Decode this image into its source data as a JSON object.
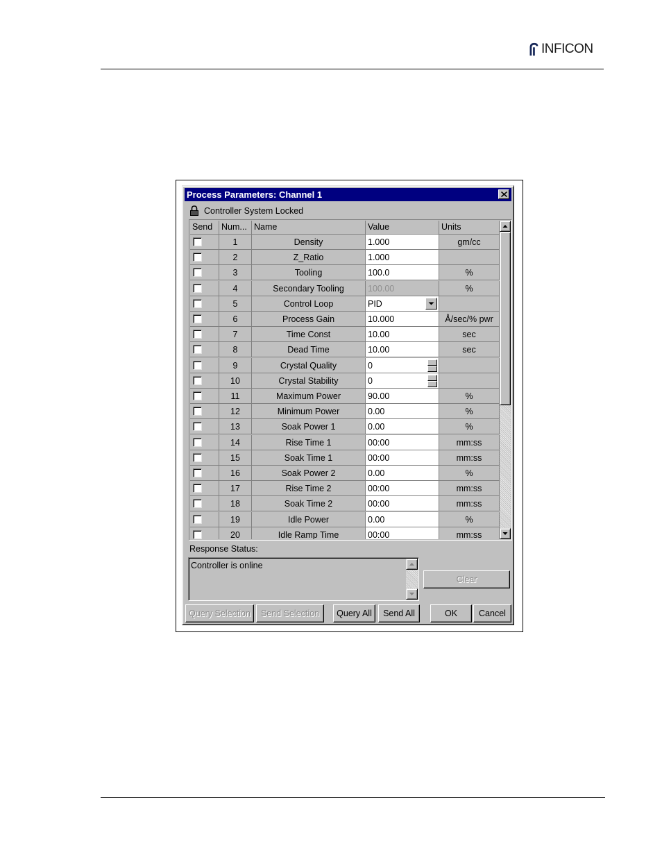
{
  "brand": {
    "logo_text": "INFICON"
  },
  "dialog": {
    "title": "Process Parameters: Channel 1",
    "lock_status": "Controller System Locked",
    "columns": [
      "Send",
      "Num...",
      "Name",
      "Value",
      "Units"
    ],
    "rows": [
      {
        "num": "1",
        "name": "Density",
        "value": "1.000",
        "units": "gm/cc",
        "control": "text"
      },
      {
        "num": "2",
        "name": "Z_Ratio",
        "value": "1.000",
        "units": "",
        "control": "text"
      },
      {
        "num": "3",
        "name": "Tooling",
        "value": "100.0",
        "units": "%",
        "control": "text"
      },
      {
        "num": "4",
        "name": "Secondary Tooling",
        "value": "100.00",
        "units": "%",
        "control": "disabled"
      },
      {
        "num": "5",
        "name": "Control Loop",
        "value": "PID",
        "units": "",
        "control": "dropdown"
      },
      {
        "num": "6",
        "name": "Process Gain",
        "value": "10.000",
        "units": "Å/sec/% pwr",
        "control": "text"
      },
      {
        "num": "7",
        "name": "Time Const",
        "value": "10.00",
        "units": "sec",
        "control": "text"
      },
      {
        "num": "8",
        "name": "Dead Time",
        "value": "10.00",
        "units": "sec",
        "control": "text"
      },
      {
        "num": "9",
        "name": "Crystal Quality",
        "value": "0",
        "units": "",
        "control": "spin"
      },
      {
        "num": "10",
        "name": "Crystal Stability",
        "value": "0",
        "units": "",
        "control": "spin"
      },
      {
        "num": "11",
        "name": "Maximum Power",
        "value": "90.00",
        "units": "%",
        "control": "text"
      },
      {
        "num": "12",
        "name": "Minimum Power",
        "value": "0.00",
        "units": "%",
        "control": "text"
      },
      {
        "num": "13",
        "name": "Soak Power 1",
        "value": "0.00",
        "units": "%",
        "control": "text"
      },
      {
        "num": "14",
        "name": "Rise Time 1",
        "value": "00:00",
        "units": "mm:ss",
        "control": "text"
      },
      {
        "num": "15",
        "name": "Soak Time 1",
        "value": "00:00",
        "units": "mm:ss",
        "control": "text"
      },
      {
        "num": "16",
        "name": "Soak Power 2",
        "value": "0.00",
        "units": "%",
        "control": "text"
      },
      {
        "num": "17",
        "name": "Rise Time 2",
        "value": "00:00",
        "units": "mm:ss",
        "control": "text"
      },
      {
        "num": "18",
        "name": "Soak Time 2",
        "value": "00:00",
        "units": "mm:ss",
        "control": "text"
      },
      {
        "num": "19",
        "name": "Idle Power",
        "value": "0.00",
        "units": "%",
        "control": "text"
      },
      {
        "num": "20",
        "name": "Idle Ramp Time",
        "value": "00:00",
        "units": "mm:ss",
        "control": "text"
      }
    ],
    "response_label": "Response Status:",
    "response_text": "Controller is online",
    "buttons": {
      "clear": "Clear",
      "query_selection": "Query Selection",
      "send_selection": "Send Selection",
      "query_all": "Query All",
      "send_all": "Send All",
      "ok": "OK",
      "cancel": "Cancel"
    }
  },
  "colors": {
    "titlebar": "#000080",
    "face": "#c0c0c0",
    "window": "#ffffff"
  }
}
